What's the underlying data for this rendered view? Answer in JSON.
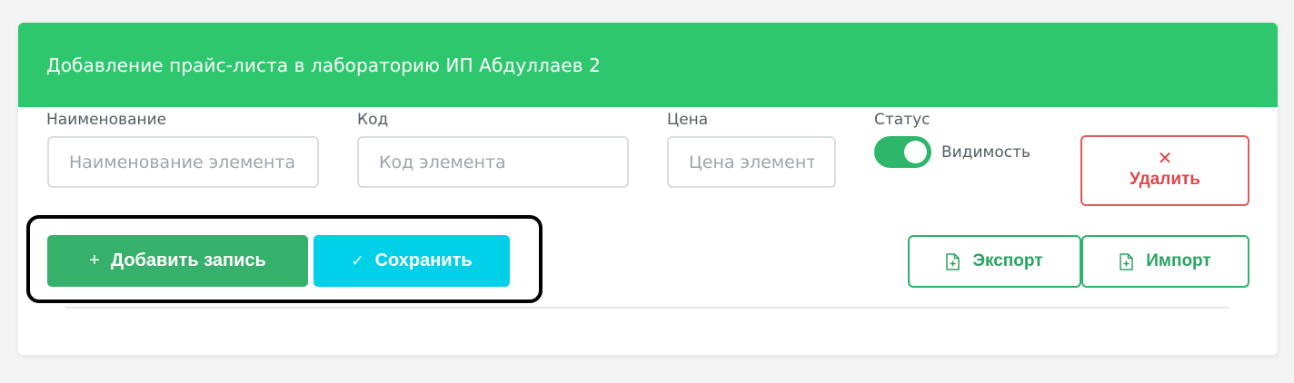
{
  "header": {
    "title": "Добавление прайс-листа в лабораторию ИП Абдуллаев 2"
  },
  "form": {
    "name": {
      "label": "Наименование",
      "placeholder": "Наименование элемента",
      "value": ""
    },
    "code": {
      "label": "Код",
      "placeholder": "Код элемента",
      "value": ""
    },
    "price": {
      "label": "Цена",
      "placeholder": "Цена элемента",
      "value": ""
    },
    "status": {
      "label": "Статус",
      "toggle_label": "Видимость",
      "enabled": true
    },
    "delete_label": "Удалить"
  },
  "actions": {
    "add_label": "Добавить запись",
    "save_label": "Сохранить",
    "export_label": "Экспорт",
    "import_label": "Импорт"
  },
  "icons": {
    "add": "plus-icon",
    "save": "check-icon",
    "delete": "close-icon",
    "export": "file-plus-icon",
    "import": "file-plus-icon"
  },
  "colors": {
    "header_bg": "#2ec76e",
    "primary_green": "#35b16b",
    "save_cyan": "#00d0e8",
    "danger_red": "#e0464a",
    "outline_green": "#2fb36b"
  }
}
